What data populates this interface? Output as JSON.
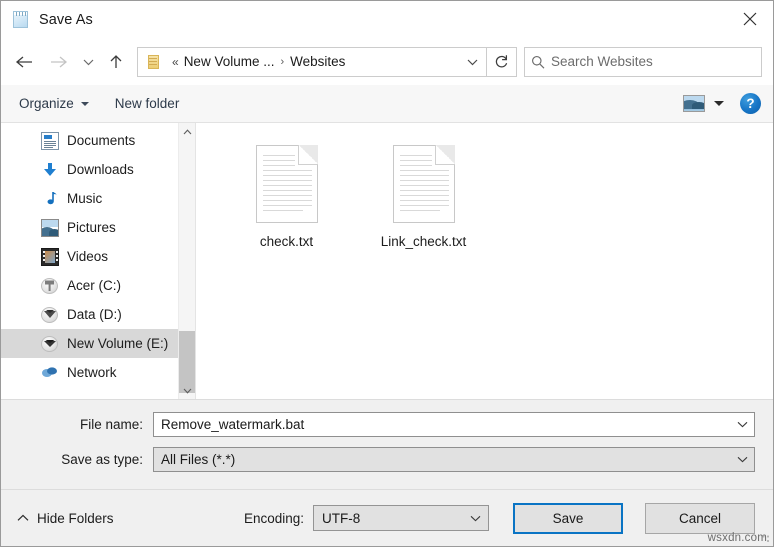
{
  "window": {
    "title": "Save As",
    "app_icon": "notepad-icon",
    "close_label": "close-icon"
  },
  "nav": {
    "back": "back-arrow-icon",
    "forward": "forward-arrow-icon",
    "recent": "recent-locations-chevron-icon",
    "up": "up-arrow-icon",
    "refresh": "refresh-icon",
    "address": {
      "folder_icon": "folder-icon",
      "overflow": "«",
      "crumbs": [
        "New Volume ...",
        "Websites"
      ],
      "separator": "›",
      "dropdown": "chevron-down-icon"
    },
    "search": {
      "icon": "search-icon",
      "placeholder": "Search Websites",
      "value": ""
    }
  },
  "toolbar": {
    "organize_label": "Organize",
    "new_folder_label": "New folder",
    "view_icon": "preview-pane-icon",
    "view_caret": "chevron-down-icon",
    "help_label": "?"
  },
  "sidebar": {
    "items": [
      {
        "label": "Documents",
        "icon": "documents-icon",
        "selected": false
      },
      {
        "label": "Downloads",
        "icon": "downloads-icon",
        "selected": false
      },
      {
        "label": "Music",
        "icon": "music-icon",
        "selected": false
      },
      {
        "label": "Pictures",
        "icon": "pictures-icon",
        "selected": false
      },
      {
        "label": "Videos",
        "icon": "videos-icon",
        "selected": false
      },
      {
        "label": "Acer (C:)",
        "icon": "drive-icon",
        "selected": false
      },
      {
        "label": "Data (D:)",
        "icon": "drive-icon",
        "selected": false
      },
      {
        "label": "New Volume (E:)",
        "icon": "drive-icon",
        "selected": true
      },
      {
        "label": "Network",
        "icon": "network-icon",
        "selected": false
      }
    ],
    "scrollbar": {
      "up_arrow": "chevron-up-icon",
      "down_arrow": "chevron-down-icon"
    }
  },
  "files": [
    {
      "name": "check.txt",
      "icon": "text-file-icon"
    },
    {
      "name": "Link_check.txt",
      "icon": "text-file-icon"
    }
  ],
  "form": {
    "file_name_label": "File name:",
    "file_name_value": "Remove_watermark.bat",
    "save_as_type_label": "Save as type:",
    "save_as_type_value": "All Files  (*.*)"
  },
  "footer": {
    "hide_folders_label": "Hide Folders",
    "hide_folders_icon": "chevron-up-icon",
    "encoding_label": "Encoding:",
    "encoding_value": "UTF-8",
    "save_label": "Save",
    "cancel_label": "Cancel",
    "watermark": "wsxdn.com"
  },
  "colors": {
    "accent": "#0a74c4",
    "chrome": "#f0f0f0",
    "content": "#ffffff",
    "selection": "#d8d8d8"
  }
}
